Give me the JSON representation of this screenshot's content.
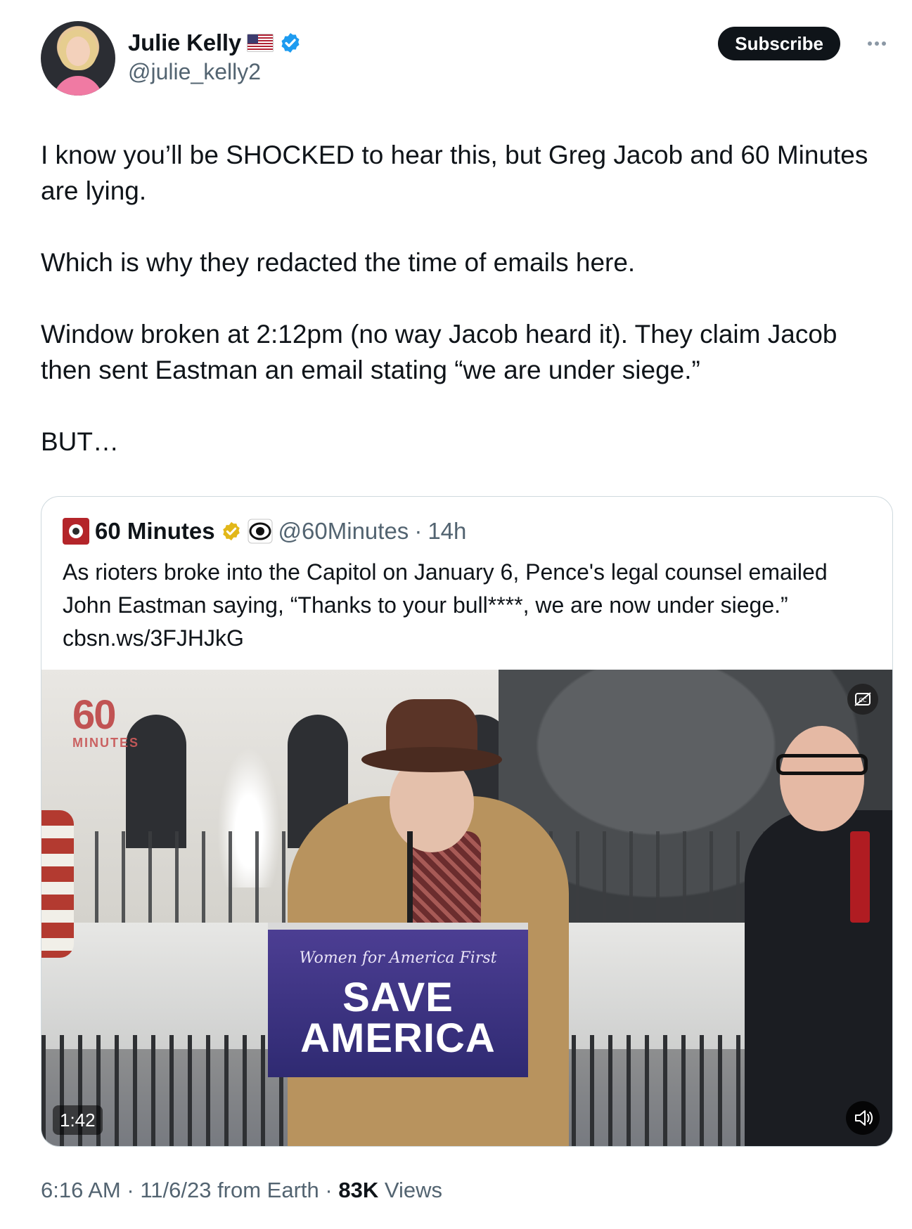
{
  "author": {
    "display_name": "Julie Kelly",
    "handle": "@julie_kelly2",
    "flag": "us-flag-icon",
    "verified": "blue-checkmark-icon"
  },
  "actions": {
    "subscribe_label": "Subscribe",
    "more": "more-options-icon"
  },
  "tweet": {
    "paragraphs": [
      "I know you’ll be SHOCKED to hear this, but Greg Jacob and 60 Minutes are lying.",
      "Which is why they redacted the time of emails here.",
      "Window broken at 2:12pm (no way Jacob heard it). They claim Jacob then sent Eastman an email stating “we are under siege.”",
      "BUT…"
    ]
  },
  "quote": {
    "name": "60 Minutes",
    "handle": "@60Minutes",
    "separator": "·",
    "time": "14h",
    "text": "As rioters broke into the Capitol on January 6, Pence's legal counsel emailed John Eastman saying, “Thanks to your bull****, we are now under siege.” cbsn.ws/3FJHJkG",
    "video": {
      "logo_number": "60",
      "logo_word": "MINUTES",
      "podium_small": "Women for America First",
      "podium_big": "SAVE\nAMERICA",
      "duration": "1:42"
    }
  },
  "meta": {
    "time": "6:16 AM",
    "separator": "·",
    "date_source": "11/6/23 from Earth",
    "views_count": "83K",
    "views_label": "Views"
  },
  "colors": {
    "text_primary": "#0f1419",
    "text_secondary": "#536471",
    "verified_blue": "#1d9bf0",
    "gold_badge": "#e2b719",
    "border": "#cfd9de"
  }
}
